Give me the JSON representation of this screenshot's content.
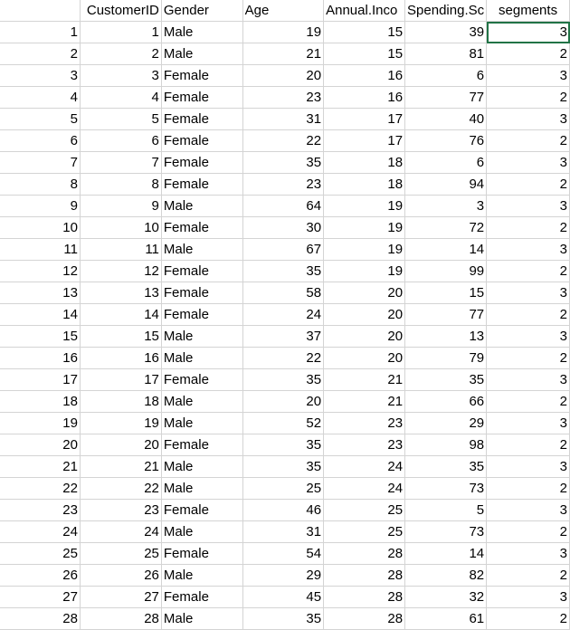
{
  "headers": [
    "",
    "CustomerID",
    "Gender",
    "Age",
    "Annual.Inco",
    "Spending.Sc",
    "segments"
  ],
  "rows": [
    [
      "1",
      "1",
      "Male",
      "19",
      "15",
      "39",
      "3"
    ],
    [
      "2",
      "2",
      "Male",
      "21",
      "15",
      "81",
      "2"
    ],
    [
      "3",
      "3",
      "Female",
      "20",
      "16",
      "6",
      "3"
    ],
    [
      "4",
      "4",
      "Female",
      "23",
      "16",
      "77",
      "2"
    ],
    [
      "5",
      "5",
      "Female",
      "31",
      "17",
      "40",
      "3"
    ],
    [
      "6",
      "6",
      "Female",
      "22",
      "17",
      "76",
      "2"
    ],
    [
      "7",
      "7",
      "Female",
      "35",
      "18",
      "6",
      "3"
    ],
    [
      "8",
      "8",
      "Female",
      "23",
      "18",
      "94",
      "2"
    ],
    [
      "9",
      "9",
      "Male",
      "64",
      "19",
      "3",
      "3"
    ],
    [
      "10",
      "10",
      "Female",
      "30",
      "19",
      "72",
      "2"
    ],
    [
      "11",
      "11",
      "Male",
      "67",
      "19",
      "14",
      "3"
    ],
    [
      "12",
      "12",
      "Female",
      "35",
      "19",
      "99",
      "2"
    ],
    [
      "13",
      "13",
      "Female",
      "58",
      "20",
      "15",
      "3"
    ],
    [
      "14",
      "14",
      "Female",
      "24",
      "20",
      "77",
      "2"
    ],
    [
      "15",
      "15",
      "Male",
      "37",
      "20",
      "13",
      "3"
    ],
    [
      "16",
      "16",
      "Male",
      "22",
      "20",
      "79",
      "2"
    ],
    [
      "17",
      "17",
      "Female",
      "35",
      "21",
      "35",
      "3"
    ],
    [
      "18",
      "18",
      "Male",
      "20",
      "21",
      "66",
      "2"
    ],
    [
      "19",
      "19",
      "Male",
      "52",
      "23",
      "29",
      "3"
    ],
    [
      "20",
      "20",
      "Female",
      "35",
      "23",
      "98",
      "2"
    ],
    [
      "21",
      "21",
      "Male",
      "35",
      "24",
      "35",
      "3"
    ],
    [
      "22",
      "22",
      "Male",
      "25",
      "24",
      "73",
      "2"
    ],
    [
      "23",
      "23",
      "Female",
      "46",
      "25",
      "5",
      "3"
    ],
    [
      "24",
      "24",
      "Male",
      "31",
      "25",
      "73",
      "2"
    ],
    [
      "25",
      "25",
      "Female",
      "54",
      "28",
      "14",
      "3"
    ],
    [
      "26",
      "26",
      "Male",
      "29",
      "28",
      "82",
      "2"
    ],
    [
      "27",
      "27",
      "Female",
      "45",
      "28",
      "32",
      "3"
    ],
    [
      "28",
      "28",
      "Male",
      "35",
      "28",
      "61",
      "2"
    ]
  ],
  "selection": {
    "row": 0,
    "col": 6,
    "color": "#217346"
  }
}
